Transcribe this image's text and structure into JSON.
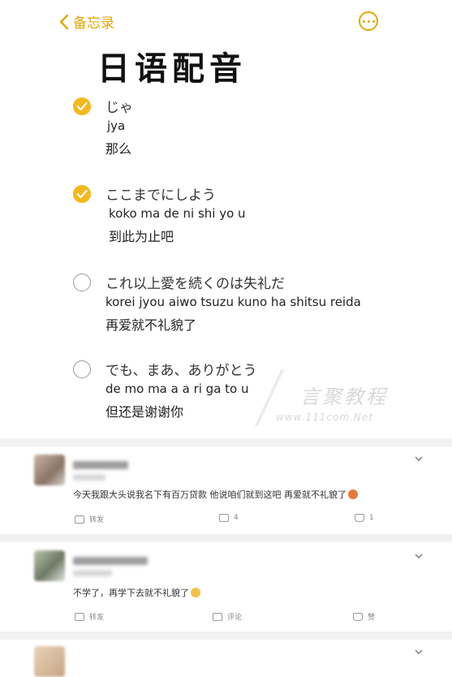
{
  "header": {
    "back_label": "备忘录"
  },
  "title": "日语配音",
  "items": [
    {
      "checked": true,
      "japanese": "じゃ",
      "romaji": "jya",
      "chinese": "那么"
    },
    {
      "checked": true,
      "japanese": "ここまでにしよう",
      "romaji": "koko ma de ni shi yo u",
      "chinese": "到此为止吧"
    },
    {
      "checked": false,
      "japanese": "これ以上愛を続くのは失礼だ",
      "romaji": "korei jyou aiwo tsuzu kuno ha shitsu reida",
      "chinese": "再爱就不礼貌了"
    },
    {
      "checked": false,
      "japanese": "でも、まあ、ありがとう",
      "romaji": "de mo ma a a ri ga to u",
      "chinese": "但还是谢谢你"
    }
  ],
  "watermark": {
    "text": "言聚教程",
    "url": "www.111com.Net"
  },
  "comments": [
    {
      "text": "今天我跟大头说我名下有百万贷款 他说咱们就到这吧 再爱就不礼貌了",
      "repost_label": "转发",
      "comment_label": "4",
      "like_label": "1"
    },
    {
      "text": "不学了，再学下去就不礼貌了",
      "repost_label": "转发",
      "comment_label": "评论",
      "like_label": "赞"
    }
  ],
  "colors": {
    "accent": "#e0a800",
    "check_fill": "#f3b81b"
  }
}
